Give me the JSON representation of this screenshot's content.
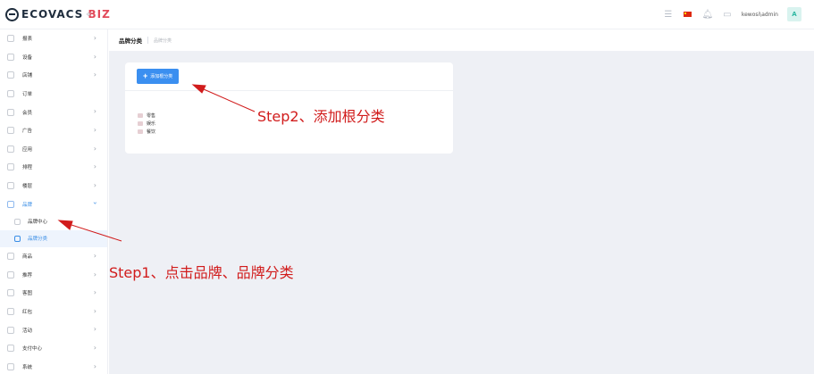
{
  "header": {
    "logo": {
      "brand": "ECOVACS",
      "suffix": "BIZ"
    },
    "collapse_icon": "chevron-double-left-icon",
    "icons": [
      "settings-sliders-icon",
      "china-flag-icon",
      "bell-icon",
      "message-icon"
    ],
    "user": "kewosi\\admin",
    "avatar_letter": "A"
  },
  "sidebar": {
    "items": [
      {
        "label": "报表",
        "icon": "report-icon"
      },
      {
        "label": "设备",
        "icon": "device-icon"
      },
      {
        "label": "店铺",
        "icon": "store-icon"
      },
      {
        "label": "订单",
        "icon": "order-icon"
      },
      {
        "label": "会员",
        "icon": "member-icon"
      },
      {
        "label": "广告",
        "icon": "ad-icon"
      },
      {
        "label": "应用",
        "icon": "app-icon"
      },
      {
        "label": "排程",
        "icon": "schedule-icon"
      },
      {
        "label": "楼层",
        "icon": "floor-icon"
      },
      {
        "label": "品牌",
        "icon": "brand-icon"
      },
      {
        "label": "商品",
        "icon": "goods-icon"
      },
      {
        "label": "推荐",
        "icon": "recommend-icon"
      },
      {
        "label": "客图",
        "icon": "image-icon"
      },
      {
        "label": "红包",
        "icon": "redpacket-icon"
      },
      {
        "label": "活动",
        "icon": "activity-icon"
      },
      {
        "label": "支付中心",
        "icon": "payment-icon"
      },
      {
        "label": "系统",
        "icon": "system-icon"
      }
    ],
    "brand_sub": [
      {
        "label": "品牌中心"
      },
      {
        "label": "品牌分类"
      }
    ]
  },
  "breadcrumb": {
    "title": "品牌分类",
    "sub": "品牌分类"
  },
  "card": {
    "add_button": "添加根分类",
    "tree": [
      "零售",
      "娱乐",
      "餐饮"
    ]
  },
  "annotations": {
    "step2": "Step2、添加根分类",
    "step1": "Step1、点击品牌、品牌分类",
    "color": "#d11c1c"
  },
  "colors": {
    "accent": "#3b8ff0",
    "active_bg": "#eef4fd",
    "content_bg": "#eef0f5"
  }
}
